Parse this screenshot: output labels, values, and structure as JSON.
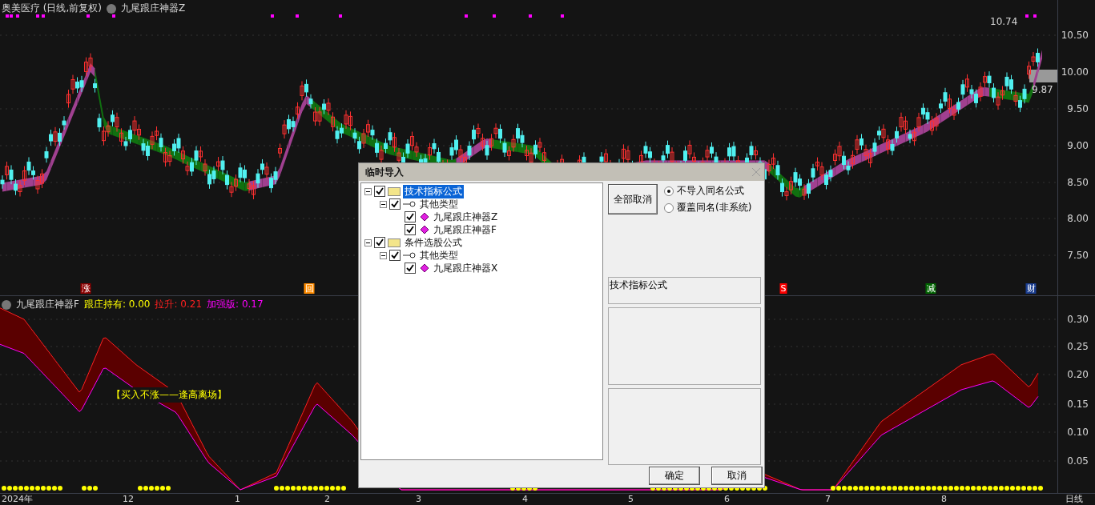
{
  "price_pane": {
    "title": "奥美医疗 (日线,前复权)",
    "indicator": "九尾跟庄神器Z",
    "high_label": "10.74",
    "low_label": "9.87",
    "yticks": [
      "10.50",
      "10.00",
      "9.50",
      "9.00",
      "8.50",
      "8.00",
      "7.50"
    ],
    "markers": [
      {
        "text": "涨",
        "color": "#8b0000"
      },
      {
        "text": "回",
        "color": "#ff8c00"
      },
      {
        "text": "S",
        "color": "#ff0000"
      },
      {
        "text": "减",
        "color": "#006400"
      },
      {
        "text": "财",
        "color": "#1a3d8f"
      }
    ]
  },
  "indicator_pane": {
    "name": "九尾跟庄神器F",
    "legend": [
      {
        "text": "跟庄持有: 0.00",
        "color": "#ffff00"
      },
      {
        "text": "拉升: 0.21",
        "color": "#ff2020"
      },
      {
        "text": "加强版: 0.17",
        "color": "#ff00ff"
      }
    ],
    "annotation": "【买入不涨——逢高离场】",
    "yticks": [
      "0.30",
      "0.25",
      "0.20",
      "0.15",
      "0.10",
      "0.05"
    ]
  },
  "x_axis": {
    "labels": [
      "2024年",
      "12",
      "1",
      "2",
      "3",
      "4",
      "5",
      "6",
      "7",
      "8"
    ],
    "period": "日线"
  },
  "dialog": {
    "title": "临时导入",
    "tree": [
      {
        "label": "技术指标公式",
        "kind": "folder",
        "checked": true,
        "selected": true,
        "expanded": true,
        "children": [
          {
            "label": "其他类型",
            "kind": "group",
            "checked": true,
            "selected": false,
            "expanded": true,
            "children": [
              {
                "label": "九尾跟庄神器Z",
                "kind": "formula",
                "checked": true,
                "selected": false
              },
              {
                "label": "九尾跟庄神器F",
                "kind": "formula",
                "checked": true,
                "selected": false
              }
            ]
          }
        ]
      },
      {
        "label": "条件选股公式",
        "kind": "folder",
        "checked": true,
        "selected": false,
        "expanded": true,
        "children": [
          {
            "label": "其他类型",
            "kind": "group",
            "checked": true,
            "selected": false,
            "expanded": true,
            "children": [
              {
                "label": "九尾跟庄神器X",
                "kind": "formula",
                "checked": true,
                "selected": false
              }
            ]
          }
        ]
      }
    ],
    "cancel_all": "全部取消",
    "options": [
      {
        "label": "不导入同名公式",
        "selected": true
      },
      {
        "label": "覆盖同名(非系统)",
        "selected": false
      }
    ],
    "category": "技术指标公式",
    "buttons": [
      "确定",
      "取消"
    ]
  }
}
